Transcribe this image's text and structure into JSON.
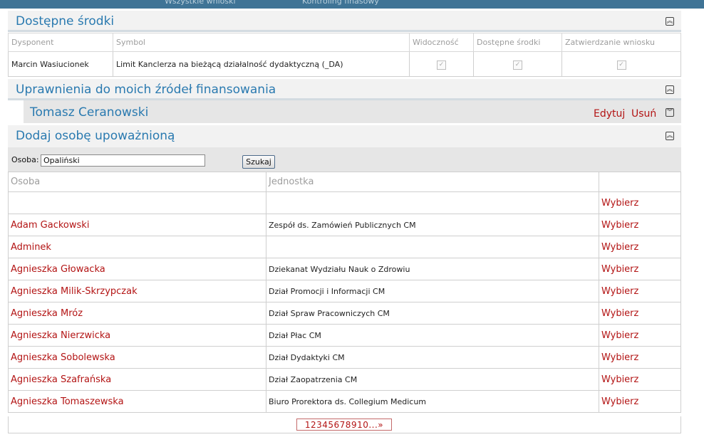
{
  "topbar": {
    "links": [
      "Wszystkie wnioski",
      "Kontroling finasowy"
    ]
  },
  "sections": {
    "available_funds": "Dostępne środki",
    "permissions": "Uprawnienia do moich źródeł finansowania",
    "add_person": "Dodaj osobę upoważnioną"
  },
  "funds_table": {
    "headers": [
      "Dysponent",
      "Symbol",
      "Widoczność",
      "Dostępne środki",
      "Zatwierdzanie wniosku"
    ],
    "rows": [
      {
        "dysponent": "Marcin Wasiucionek",
        "symbol": "Limit Kanclerza na bieżącą działalność dydaktyczną (_DA)"
      }
    ]
  },
  "authorized_person": {
    "name": "Tomasz Ceranowski",
    "edit": "Edytuj",
    "delete": "Usuń"
  },
  "search": {
    "label": "Osoba:",
    "value": "Opaliński",
    "button": "Szukaj"
  },
  "results_table": {
    "headers": [
      "Osoba",
      "Jednostka",
      ""
    ],
    "select_label": "Wybierz",
    "rows": [
      {
        "osoba": "",
        "jednostka": ""
      },
      {
        "osoba": "Adam Gackowski",
        "jednostka": "Zespół ds. Zamówień Publicznych CM"
      },
      {
        "osoba": "Adminek",
        "jednostka": ""
      },
      {
        "osoba": "Agnieszka Głowacka",
        "jednostka": "Dziekanat Wydziału Nauk o Zdrowiu"
      },
      {
        "osoba": "Agnieszka Milik-Skrzypczak",
        "jednostka": "Dział Promocji i Informacji CM"
      },
      {
        "osoba": "Agnieszka Mróz",
        "jednostka": "Dział Spraw Pracowniczych CM"
      },
      {
        "osoba": "Agnieszka Nierzwicka",
        "jednostka": "Dział Płac CM"
      },
      {
        "osoba": "Agnieszka Sobolewska",
        "jednostka": "Dział Dydaktyki CM"
      },
      {
        "osoba": "Agnieszka Szafrańska",
        "jednostka": "Dział Zaopatrzenia CM"
      },
      {
        "osoba": "Agnieszka Tomaszewska",
        "jednostka": "Biuro Prorektora ds. Collegium Medicum"
      }
    ]
  },
  "pager": {
    "text": "12345678910...»"
  },
  "colors": {
    "accent": "#2a7ab0",
    "link_red": "#b31414",
    "topbar": "#3f7496"
  }
}
